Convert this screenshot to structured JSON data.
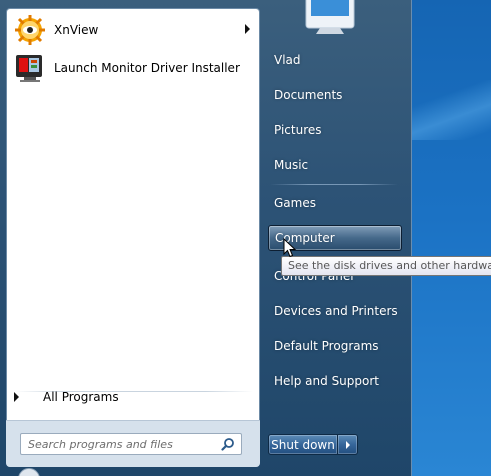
{
  "pinned": [
    {
      "label": "XnView",
      "icon": "xnview-icon",
      "has_submenu": true
    },
    {
      "label": "Launch Monitor Driver Installer",
      "icon": "monitor-driver-icon",
      "has_submenu": false
    }
  ],
  "all_programs": {
    "label": "All Programs"
  },
  "search": {
    "placeholder": "Search programs and files",
    "icon": "search-icon"
  },
  "right_menu": [
    {
      "label": "Vlad"
    },
    {
      "label": "Documents"
    },
    {
      "label": "Pictures"
    },
    {
      "label": "Music"
    },
    {
      "label": "Games"
    },
    {
      "label": "Computer",
      "highlighted": true
    },
    {
      "label": "Control Panel"
    },
    {
      "label": "Devices and Printers"
    },
    {
      "label": "Default Programs"
    },
    {
      "label": "Help and Support"
    }
  ],
  "shutdown": {
    "label": "Shut down"
  },
  "tooltip": {
    "text": "See the disk drives and other hardware"
  },
  "colors": {
    "panel": "#2d5376",
    "left_pane": "#ffffff",
    "desktop": "#1b72c4"
  }
}
